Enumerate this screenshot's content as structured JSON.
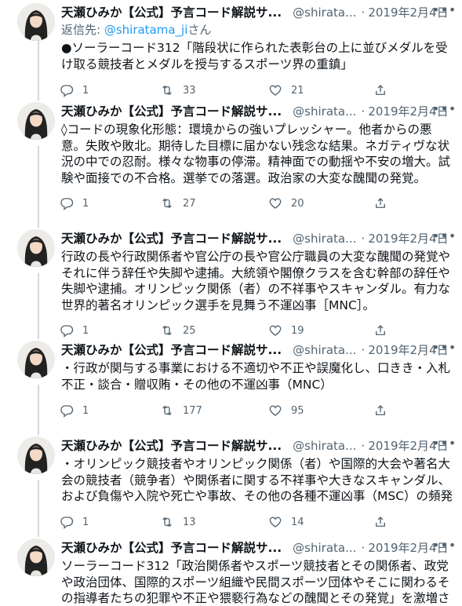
{
  "tweets": [
    {
      "name": "天瀬ひみか【公式】予言コード解説サ...",
      "handle": "@shirata...",
      "date": "2019年2月4日",
      "reply_prefix": "返信先: ",
      "reply_handle": "@shiratama_ji",
      "reply_suffix": "さん",
      "text": "●ソーラーコード312「階段状に作られた表彰台の上に並びメダルを受け取る競技者とメダルを授与するスポーツ界の重鎮」",
      "replies": "1",
      "retweets": "33",
      "likes": "21"
    },
    {
      "name": "天瀬ひみか【公式】予言コード解説サ...",
      "handle": "@shirata...",
      "date": "2019年2月4日",
      "text": "◊コードの現象化形態：環境からの強いプレッシャー。他者からの悪意。失敗や敗北。期待した目標に届かない残念な結果。ネガティヴな状況の中での忍耐。様々な物事の停滞。精神面での動揺や不安の増大。試験や面接での不合格。選挙での落選。政治家の大変な醜聞の発覚。",
      "replies": "1",
      "retweets": "27",
      "likes": "20"
    },
    {
      "name": "天瀬ひみか【公式】予言コード解説サ...",
      "handle": "@shirata...",
      "date": "2019年2月4日",
      "text": "行政の長や行政関係者や官公庁の長や官公庁職員の大変な醜聞の発覚やそれに伴う辞任や失脚や逮捕。大統領や閣僚クラスを含む幹部の辞任や失脚や逮捕。オリンピック関係（者）の不祥事やスキャンダル。有力な世界的著名オリンピック選手を見舞う不運凶事［MNC］。",
      "replies": "1",
      "retweets": "25",
      "likes": "19"
    },
    {
      "name": "天瀬ひみか【公式】予言コード解説サ...",
      "handle": "@shirata...",
      "date": "2019年2月4日",
      "text": "・行政が関与する事業における不適切や不正や誤魔化し、口きき・入札不正・談合・贈収賄・その他の不運凶事（MNC）",
      "replies": "1",
      "retweets": "177",
      "likes": "95"
    },
    {
      "name": "天瀬ひみか【公式】予言コード解説サ...",
      "handle": "@shirata...",
      "date": "2019年2月4日",
      "text": "・オリンピック競技者やオリンピック関係（者）や国際的大会や著名大会の競技者（競争者）や関係者に関する不祥事や大きなスキャンダル、および負傷や入院や死亡や事故、その他の各種不運凶事（MSC）の頻発",
      "replies": "1",
      "retweets": "13",
      "likes": "14"
    },
    {
      "name": "天瀬ひみか【公式】予言コード解説サ...",
      "handle": "@shirata...",
      "date": "2019年2月4日",
      "text": "ソーラーコード312「政治関係者やスポーツ競技者とその関係者、政党や政治団体、国際的スポーツ組織や民間スポーツ団体やそこに関わるその指導者たちの犯罪や不正や猥褻行為などの醜聞とその発覚」を激増させる"
    }
  ],
  "icons": {
    "reply": "reply-icon",
    "retweet": "retweet-icon",
    "like": "heart-icon",
    "share": "share-icon",
    "more": "more-icon"
  },
  "colors": {
    "text": "#0f1419",
    "secondary": "#536471",
    "link": "#1d9bf0",
    "thread_line": "#cfd9de"
  }
}
